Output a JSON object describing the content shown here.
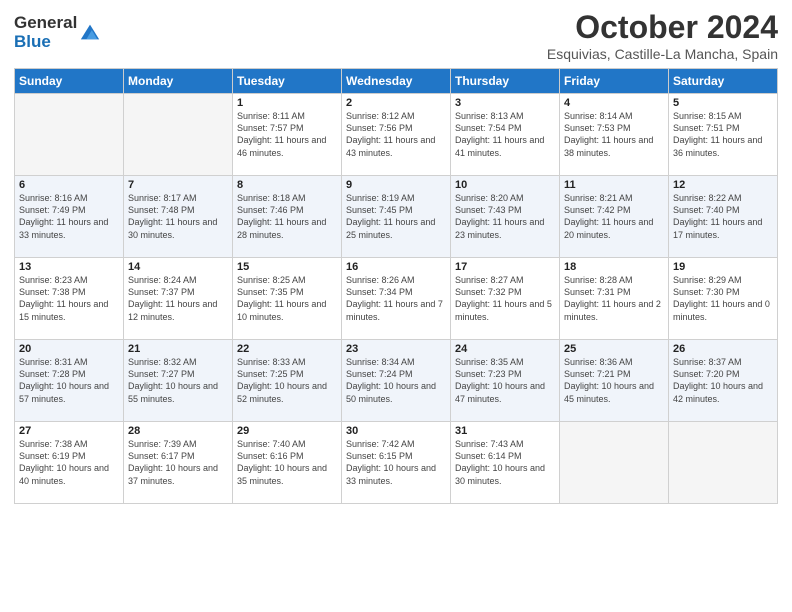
{
  "header": {
    "logo_general": "General",
    "logo_blue": "Blue",
    "month_title": "October 2024",
    "location": "Esquivias, Castille-La Mancha, Spain"
  },
  "days_of_week": [
    "Sunday",
    "Monday",
    "Tuesday",
    "Wednesday",
    "Thursday",
    "Friday",
    "Saturday"
  ],
  "weeks": [
    [
      {
        "day": "",
        "info": ""
      },
      {
        "day": "",
        "info": ""
      },
      {
        "day": "1",
        "info": "Sunrise: 8:11 AM\nSunset: 7:57 PM\nDaylight: 11 hours and 46 minutes."
      },
      {
        "day": "2",
        "info": "Sunrise: 8:12 AM\nSunset: 7:56 PM\nDaylight: 11 hours and 43 minutes."
      },
      {
        "day": "3",
        "info": "Sunrise: 8:13 AM\nSunset: 7:54 PM\nDaylight: 11 hours and 41 minutes."
      },
      {
        "day": "4",
        "info": "Sunrise: 8:14 AM\nSunset: 7:53 PM\nDaylight: 11 hours and 38 minutes."
      },
      {
        "day": "5",
        "info": "Sunrise: 8:15 AM\nSunset: 7:51 PM\nDaylight: 11 hours and 36 minutes."
      }
    ],
    [
      {
        "day": "6",
        "info": "Sunrise: 8:16 AM\nSunset: 7:49 PM\nDaylight: 11 hours and 33 minutes."
      },
      {
        "day": "7",
        "info": "Sunrise: 8:17 AM\nSunset: 7:48 PM\nDaylight: 11 hours and 30 minutes."
      },
      {
        "day": "8",
        "info": "Sunrise: 8:18 AM\nSunset: 7:46 PM\nDaylight: 11 hours and 28 minutes."
      },
      {
        "day": "9",
        "info": "Sunrise: 8:19 AM\nSunset: 7:45 PM\nDaylight: 11 hours and 25 minutes."
      },
      {
        "day": "10",
        "info": "Sunrise: 8:20 AM\nSunset: 7:43 PM\nDaylight: 11 hours and 23 minutes."
      },
      {
        "day": "11",
        "info": "Sunrise: 8:21 AM\nSunset: 7:42 PM\nDaylight: 11 hours and 20 minutes."
      },
      {
        "day": "12",
        "info": "Sunrise: 8:22 AM\nSunset: 7:40 PM\nDaylight: 11 hours and 17 minutes."
      }
    ],
    [
      {
        "day": "13",
        "info": "Sunrise: 8:23 AM\nSunset: 7:38 PM\nDaylight: 11 hours and 15 minutes."
      },
      {
        "day": "14",
        "info": "Sunrise: 8:24 AM\nSunset: 7:37 PM\nDaylight: 11 hours and 12 minutes."
      },
      {
        "day": "15",
        "info": "Sunrise: 8:25 AM\nSunset: 7:35 PM\nDaylight: 11 hours and 10 minutes."
      },
      {
        "day": "16",
        "info": "Sunrise: 8:26 AM\nSunset: 7:34 PM\nDaylight: 11 hours and 7 minutes."
      },
      {
        "day": "17",
        "info": "Sunrise: 8:27 AM\nSunset: 7:32 PM\nDaylight: 11 hours and 5 minutes."
      },
      {
        "day": "18",
        "info": "Sunrise: 8:28 AM\nSunset: 7:31 PM\nDaylight: 11 hours and 2 minutes."
      },
      {
        "day": "19",
        "info": "Sunrise: 8:29 AM\nSunset: 7:30 PM\nDaylight: 11 hours and 0 minutes."
      }
    ],
    [
      {
        "day": "20",
        "info": "Sunrise: 8:31 AM\nSunset: 7:28 PM\nDaylight: 10 hours and 57 minutes."
      },
      {
        "day": "21",
        "info": "Sunrise: 8:32 AM\nSunset: 7:27 PM\nDaylight: 10 hours and 55 minutes."
      },
      {
        "day": "22",
        "info": "Sunrise: 8:33 AM\nSunset: 7:25 PM\nDaylight: 10 hours and 52 minutes."
      },
      {
        "day": "23",
        "info": "Sunrise: 8:34 AM\nSunset: 7:24 PM\nDaylight: 10 hours and 50 minutes."
      },
      {
        "day": "24",
        "info": "Sunrise: 8:35 AM\nSunset: 7:23 PM\nDaylight: 10 hours and 47 minutes."
      },
      {
        "day": "25",
        "info": "Sunrise: 8:36 AM\nSunset: 7:21 PM\nDaylight: 10 hours and 45 minutes."
      },
      {
        "day": "26",
        "info": "Sunrise: 8:37 AM\nSunset: 7:20 PM\nDaylight: 10 hours and 42 minutes."
      }
    ],
    [
      {
        "day": "27",
        "info": "Sunrise: 7:38 AM\nSunset: 6:19 PM\nDaylight: 10 hours and 40 minutes."
      },
      {
        "day": "28",
        "info": "Sunrise: 7:39 AM\nSunset: 6:17 PM\nDaylight: 10 hours and 37 minutes."
      },
      {
        "day": "29",
        "info": "Sunrise: 7:40 AM\nSunset: 6:16 PM\nDaylight: 10 hours and 35 minutes."
      },
      {
        "day": "30",
        "info": "Sunrise: 7:42 AM\nSunset: 6:15 PM\nDaylight: 10 hours and 33 minutes."
      },
      {
        "day": "31",
        "info": "Sunrise: 7:43 AM\nSunset: 6:14 PM\nDaylight: 10 hours and 30 minutes."
      },
      {
        "day": "",
        "info": ""
      },
      {
        "day": "",
        "info": ""
      }
    ]
  ]
}
